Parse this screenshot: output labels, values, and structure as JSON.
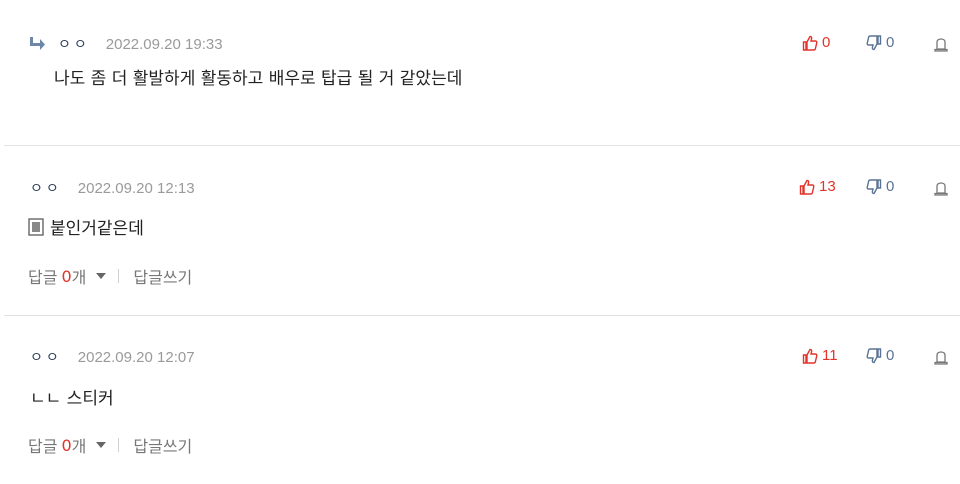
{
  "comments": [
    {
      "is_reply": true,
      "author": "ㅇㅇ",
      "date": "2022.09.20 19:33",
      "text": "나도 좀 더 활발하게 활동하고 배우로 탑급 될 거 같았는데",
      "likes": "0",
      "dislikes": "0"
    },
    {
      "is_reply": false,
      "author": "ㅇㅇ",
      "date": "2022.09.20 12:13",
      "text": "붙인거같은데",
      "has_sticker": true,
      "likes": "13",
      "dislikes": "0",
      "reply_label": "답글",
      "reply_count": "0",
      "reply_unit": "개",
      "write_reply": "답글쓰기"
    },
    {
      "is_reply": false,
      "author": "ㅇㅇ",
      "date": "2022.09.20 12:07",
      "text": "ㄴㄴ 스티커",
      "likes": "11",
      "dislikes": "0",
      "reply_label": "답글",
      "reply_count": "0",
      "reply_unit": "개",
      "write_reply": "답글쓰기"
    }
  ],
  "colors": {
    "like": "#e0342a",
    "dislike": "#5a7394",
    "author": "#2b3f5c",
    "date": "#9a9a9a"
  }
}
